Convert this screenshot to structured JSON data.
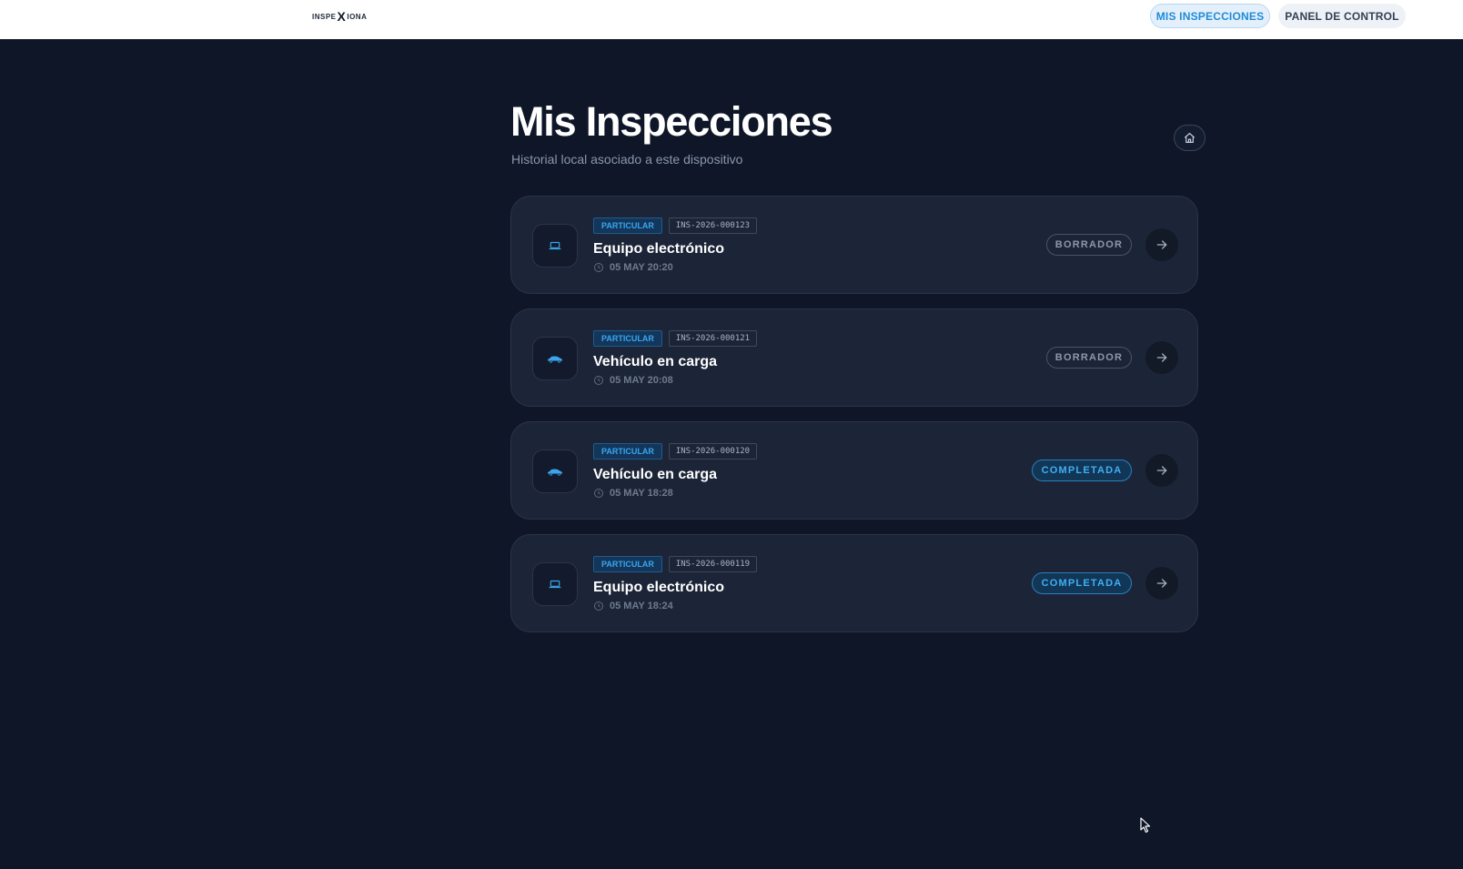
{
  "header": {
    "logo_left": "INSPE",
    "logo_x": "X",
    "logo_right": "IONA",
    "nav": [
      {
        "label": "MIS INSPECCIONES",
        "active": true
      },
      {
        "label": "PANEL DE CONTROL",
        "active": false
      }
    ]
  },
  "main": {
    "title": "Mis Inspecciones",
    "subtitle": "Historial local asociado a este dispositivo",
    "home_icon": "home-icon"
  },
  "inspections": [
    {
      "type": "PARTICULAR",
      "id": "INS-2026-000123",
      "title": "Equipo electrónico",
      "date": "05 MAY 20:20",
      "status": "BORRADOR",
      "icon": "laptop-icon"
    },
    {
      "type": "PARTICULAR",
      "id": "INS-2026-000121",
      "title": "Vehículo en carga",
      "date": "05 MAY 20:08",
      "status": "BORRADOR",
      "icon": "car-icon"
    },
    {
      "type": "PARTICULAR",
      "id": "INS-2026-000120",
      "title": "Vehículo en carga",
      "date": "05 MAY 18:28",
      "status": "COMPLETADA",
      "icon": "car-icon"
    },
    {
      "type": "PARTICULAR",
      "id": "INS-2026-000119",
      "title": "Equipo electrónico",
      "date": "05 MAY 18:24",
      "status": "COMPLETADA",
      "icon": "laptop-icon"
    }
  ],
  "colors": {
    "background": "#0e1628",
    "card": "#1c2537",
    "accent": "#39a6f0"
  }
}
